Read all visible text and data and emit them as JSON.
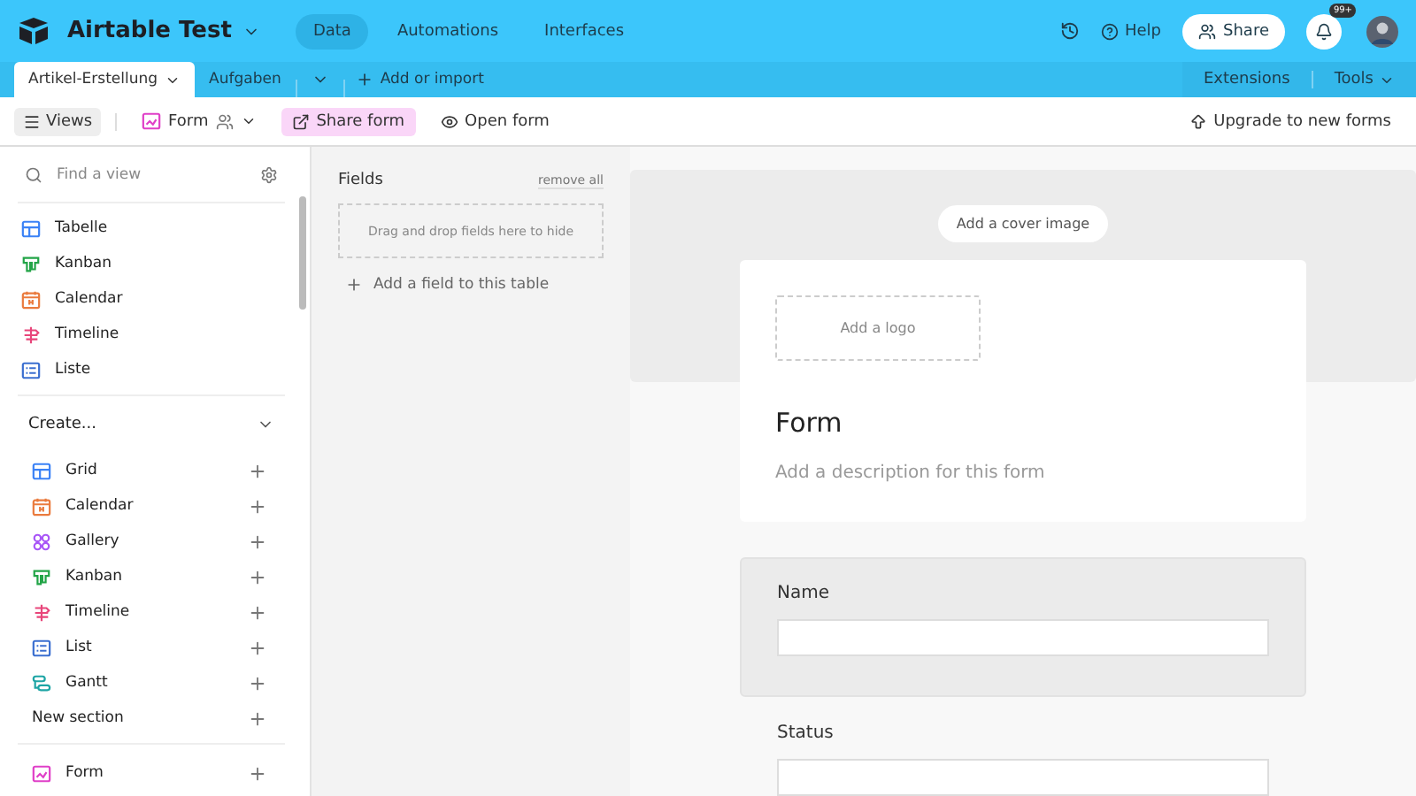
{
  "app": {
    "title": "Airtable Test",
    "nav": [
      {
        "label": "Data",
        "selected": true
      },
      {
        "label": "Automations",
        "selected": false
      },
      {
        "label": "Interfaces",
        "selected": false
      }
    ],
    "help": "Help",
    "share": "Share",
    "badge": "99+"
  },
  "tables": [
    {
      "label": "Artikel-Erstellung",
      "selected": true
    },
    {
      "label": "Aufgaben",
      "selected": false
    }
  ],
  "add_import": "Add or import",
  "extensions": "Extensions",
  "tools": "Tools",
  "toolbar": {
    "views": "Views",
    "view_name": "Form",
    "share_form": "Share form",
    "open_form": "Open form",
    "upgrade": "Upgrade to new forms"
  },
  "sidebar": {
    "search": {
      "placeholder": "Find a view"
    },
    "views": [
      {
        "label": "Tabelle",
        "kind": "grid"
      },
      {
        "label": "Kanban",
        "kind": "kanban"
      },
      {
        "label": "Calendar",
        "kind": "calendar"
      },
      {
        "label": "Timeline",
        "kind": "timeline"
      },
      {
        "label": "Liste",
        "kind": "list"
      }
    ],
    "create": {
      "title": "Create...",
      "items": [
        {
          "label": "Grid",
          "kind": "grid"
        },
        {
          "label": "Calendar",
          "kind": "calendar"
        },
        {
          "label": "Gallery",
          "kind": "gallery"
        },
        {
          "label": "Kanban",
          "kind": "kanban"
        },
        {
          "label": "Timeline",
          "kind": "timeline"
        },
        {
          "label": "List",
          "kind": "list"
        },
        {
          "label": "Gantt",
          "kind": "gantt"
        }
      ]
    },
    "new_section": "New section",
    "bottom": [
      {
        "label": "Form",
        "kind": "form"
      }
    ]
  },
  "fields": {
    "title": "Fields",
    "remove_all": "remove all",
    "drop_hint": "Drag and drop fields here to hide",
    "add_field": "Add a field to this table"
  },
  "form": {
    "cover_button": "Add a cover image",
    "logo": "Add a logo",
    "title": "Form",
    "description": "Add a description for this form",
    "fields": [
      {
        "label": "Name",
        "selected": true
      },
      {
        "label": "Status",
        "selected": false
      }
    ]
  }
}
